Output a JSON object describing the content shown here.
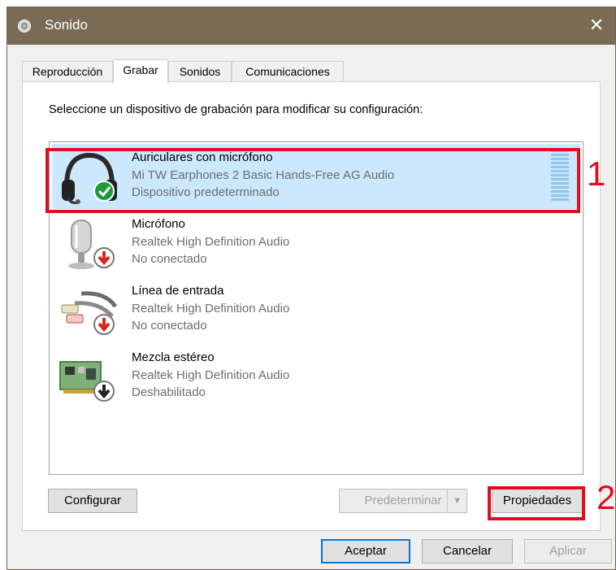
{
  "window": {
    "title": "Sonido",
    "close_glyph": "✕"
  },
  "tabs": [
    {
      "label": "Reproducción"
    },
    {
      "label": "Grabar",
      "active": true
    },
    {
      "label": "Sonidos"
    },
    {
      "label": "Comunicaciones"
    }
  ],
  "instruction": "Seleccione un dispositivo de grabación para modificar su configuración:",
  "devices": [
    {
      "name": "Auriculares con micrófono",
      "driver": "Mi TW Earphones 2 Basic Hands-Free AG Audio",
      "status": "Dispositivo predeterminado",
      "icon": "headset-icon",
      "badge": "default-check-icon",
      "selected": true
    },
    {
      "name": "Micrófono",
      "driver": "Realtek High Definition Audio",
      "status": "No conectado",
      "icon": "microphone-icon",
      "badge": "unplugged-arrow-icon"
    },
    {
      "name": "Línea de entrada",
      "driver": "Realtek High Definition Audio",
      "status": "No conectado",
      "icon": "line-in-cable-icon",
      "badge": "unplugged-arrow-icon"
    },
    {
      "name": "Mezcla estéreo",
      "driver": "Realtek High Definition Audio",
      "status": "Deshabilitado",
      "icon": "sound-card-icon",
      "badge": "disabled-arrow-icon"
    }
  ],
  "buttons": {
    "configure": "Configurar",
    "set_default": "Predeterminar",
    "properties": "Propiedades",
    "ok": "Aceptar",
    "cancel": "Cancelar",
    "apply": "Aplicar"
  },
  "annotations": {
    "one": "1",
    "two": "2"
  },
  "colors": {
    "titlebar": "#7a6b55",
    "selection": "#cce8ff",
    "annotation_red": "#e10d1f",
    "default_button_border": "#0078d7"
  }
}
